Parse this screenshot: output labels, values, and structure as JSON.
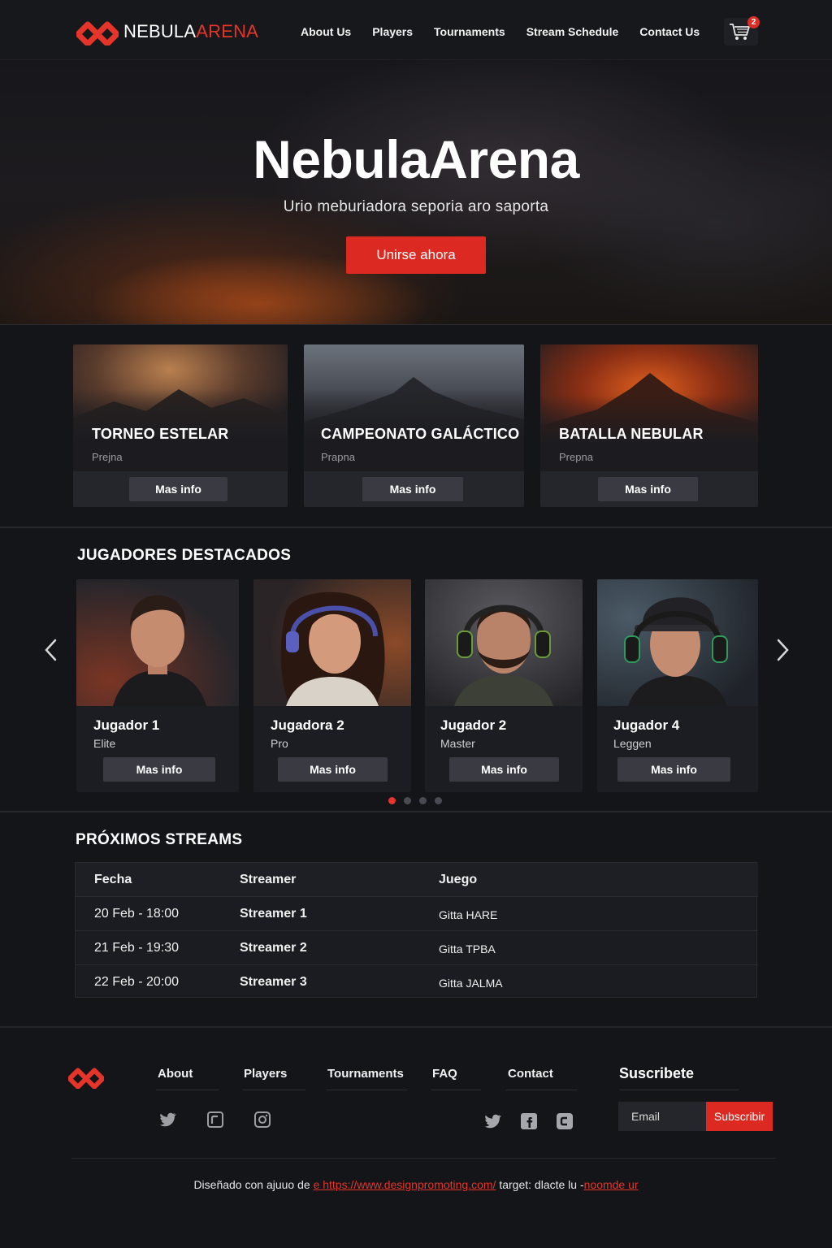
{
  "brand": {
    "name_white": "NEBULA",
    "name_red": "ARENA"
  },
  "nav": {
    "links": [
      "About Us",
      "Players",
      "Tournaments",
      "Stream Schedule",
      "Contact Us"
    ],
    "cart_count": "2"
  },
  "hero": {
    "title": "NebulaArena",
    "subtitle": "Urio meburiadora seporia aro saporta",
    "cta": "Unirse ahora"
  },
  "tournaments": [
    {
      "title": "TORNEO ESTELAR",
      "subtitle": "Prejna",
      "button": "Mas info"
    },
    {
      "title": "CAMPEONATO GALÁCTICO",
      "subtitle": "Prapna",
      "button": "Mas info"
    },
    {
      "title": "BATALLA NEBULAR",
      "subtitle": "Prepna",
      "button": "Mas info"
    }
  ],
  "players": {
    "section_title": "JUGADORES DESTACADOS",
    "items": [
      {
        "name": "Jugador 1",
        "rank": "Elite",
        "button": "Mas info"
      },
      {
        "name": "Jugadora 2",
        "rank": "Pro",
        "button": "Mas info"
      },
      {
        "name": "Jugador 2",
        "rank": "Master",
        "button": "Mas info"
      },
      {
        "name": "Jugador 4",
        "rank": "Leggen",
        "button": "Mas info"
      }
    ],
    "pagination": {
      "pages": 4,
      "active": 1
    }
  },
  "streams": {
    "section_title": "PRÓXIMOS STREAMS",
    "headers": [
      "Fecha",
      "Streamer",
      "Juego"
    ],
    "rows": [
      [
        "20 Feb - 18:00",
        "Streamer 1",
        "Gitta HARE"
      ],
      [
        "21 Feb - 19:30",
        "Streamer 2",
        "Gitta TPBA"
      ],
      [
        "22 Feb - 20:00",
        "Streamer 3",
        "Gitta JALMA"
      ]
    ]
  },
  "footer": {
    "links": [
      "About",
      "Players",
      "Tournaments",
      "FAQ",
      "Contact"
    ],
    "subscribe_title": "Suscribete",
    "email_placeholder": "Email",
    "subscribe_button": "Subscribir",
    "credit_prefix": "Diseñado con ajuuo de",
    "credit_link": "e https://www.designpromoting.com/",
    "credit_middle": "target: dlacte lu -",
    "credit_link2": "noomde ur"
  },
  "colors": {
    "accent": "#dc2a22",
    "background": "#141519"
  }
}
